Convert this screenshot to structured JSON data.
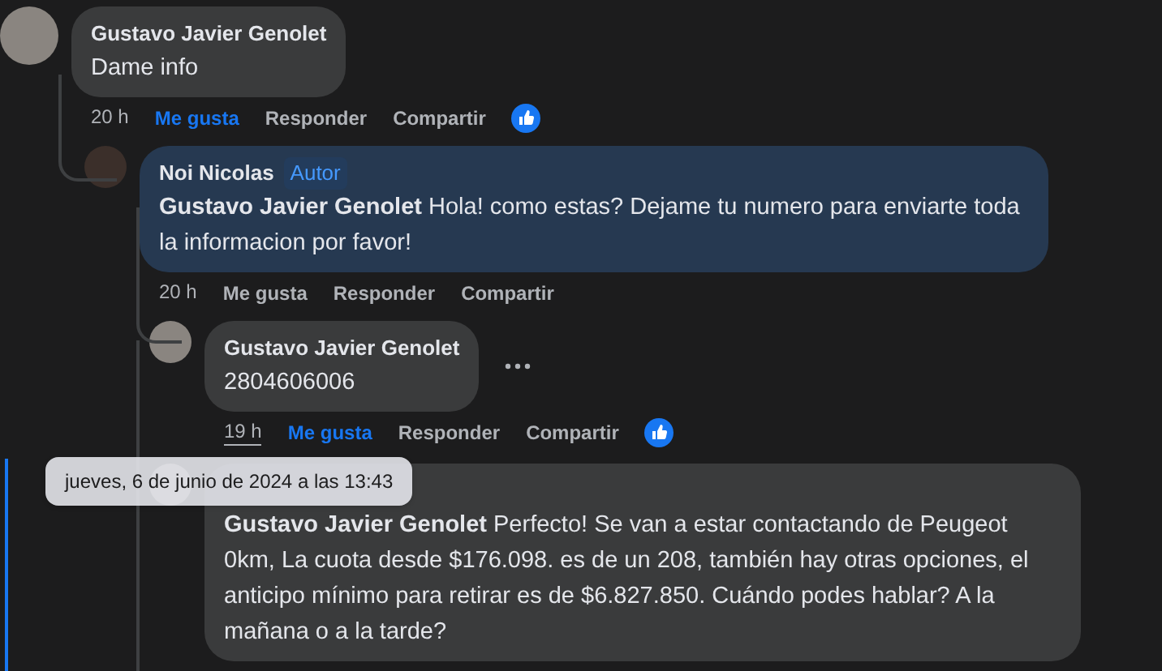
{
  "comments": [
    {
      "author": "Gustavo Javier Genolet",
      "text": "Dame info",
      "highlighted": false,
      "time": "20 h",
      "actions": [
        {
          "label": "Me gusta",
          "selected": true
        },
        {
          "label": "Responder",
          "selected": false
        },
        {
          "label": "Compartir",
          "selected": false
        }
      ],
      "reacted": true,
      "children": [
        {
          "author": "Noi Nicolas",
          "author_badge": "Autor",
          "text": "**Gustavo Javier Genolet** Hola! como estas? Dejame tu numero para enviarte toda la informacion por favor!",
          "highlighted": true,
          "time": "20 h",
          "actions": [
            {
              "label": "Me gusta",
              "selected": false
            },
            {
              "label": "Responder",
              "selected": false
            },
            {
              "label": "Compartir",
              "selected": false
            }
          ],
          "children": [
            {
              "author": "Gustavo Javier Genolet",
              "text": "2804606006",
              "highlighted": false,
              "time": "19 h",
              "time_hovered": true,
              "actions": [
                {
                  "label": "Me gusta",
                  "selected": true
                },
                {
                  "label": "Responder",
                  "selected": false
                },
                {
                  "label": "Compartir",
                  "selected": false
                }
              ],
              "reacted": true,
              "more_menu": true
            },
            {
              "text": "**Gustavo Javier Genolet** Perfecto! Se van a estar contactando de Peugeot 0km, La cuota desde $176.098. es de un 208, también hay otras opciones, el anticipo mínimo para retirar es de $6.827.850. Cuándo podes hablar? A la mañana o a la tarde?",
              "highlighted": false,
              "focused": true
            }
          ]
        }
      ]
    }
  ],
  "tooltip": {
    "text": "jueves, 6 de junio de 2024 a las 13:43"
  }
}
